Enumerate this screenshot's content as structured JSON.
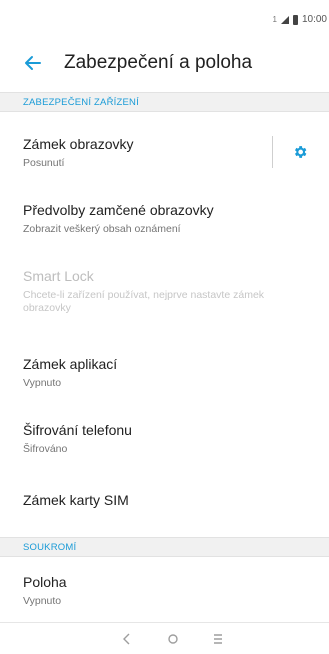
{
  "status_bar": {
    "sim_indicator": "1",
    "time": "10:00"
  },
  "header": {
    "title": "Zabezpečení a poloha",
    "accent_color": "#1a9bd7"
  },
  "sections": {
    "device_security": "ZABEZPEČENÍ ZAŘÍZENÍ",
    "privacy": "SOUKROMÍ"
  },
  "items": {
    "screen_lock": {
      "label": "Zámek obrazovky",
      "sub": "Posunutí"
    },
    "lock_screen_prefs": {
      "label": "Předvolby zamčené obrazovky",
      "sub": "Zobrazit veškerý obsah oznámení"
    },
    "smart_lock": {
      "label": "Smart Lock",
      "sub": "Chcete-li zařízení používat, nejprve nastavte zámek obrazovky"
    },
    "app_lock": {
      "label": "Zámek aplikací",
      "sub": "Vypnuto"
    },
    "phone_encryption": {
      "label": "Šifrování telefonu",
      "sub": "Šifrováno"
    },
    "sim_lock": {
      "label": "Zámek karty SIM"
    },
    "location": {
      "label": "Poloha",
      "sub": "Vypnuto"
    }
  },
  "icons": {
    "back": "arrow-left-icon",
    "settings": "gear-icon",
    "nav_back": "chevron-left-icon",
    "nav_home": "circle-icon",
    "nav_menu": "menu-icon"
  }
}
